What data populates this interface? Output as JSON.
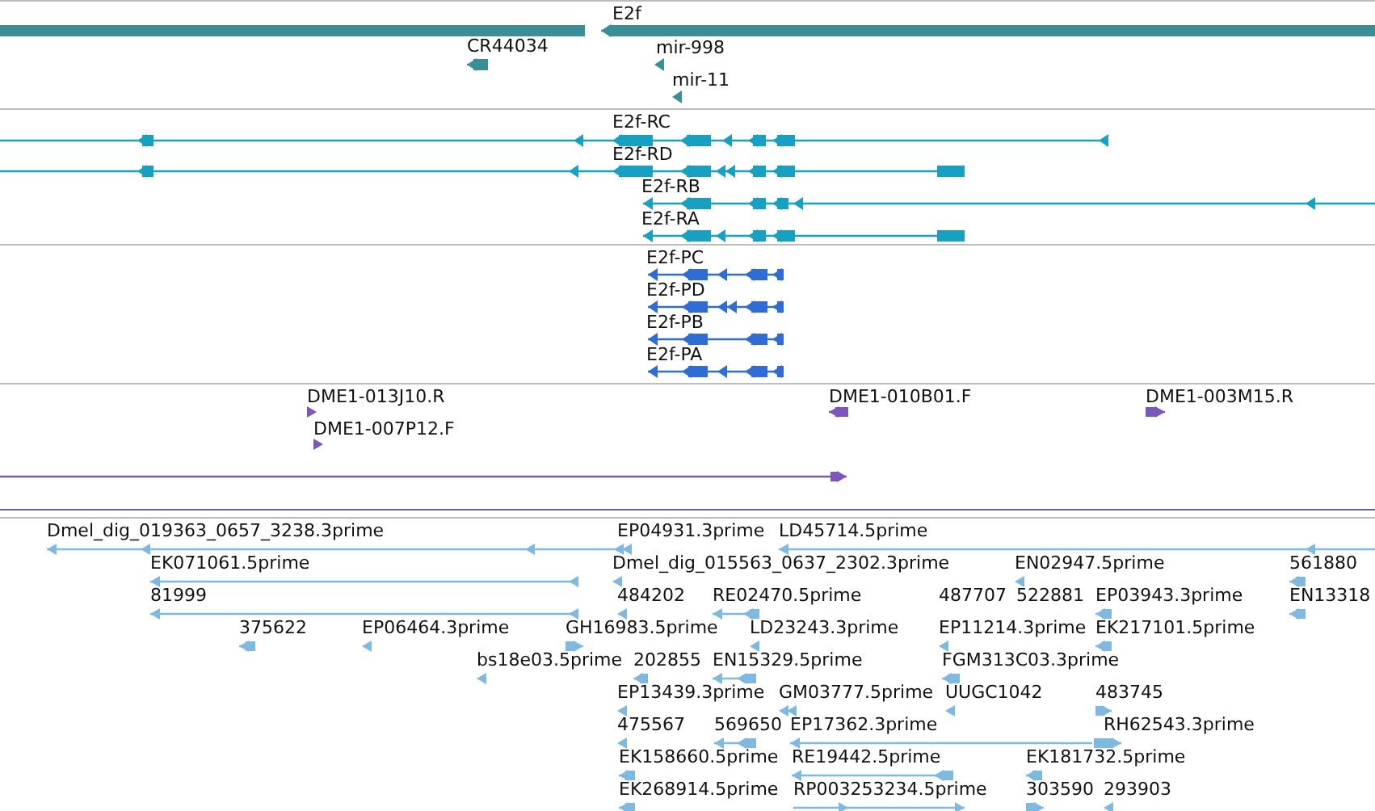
{
  "tracks": [
    {
      "kind": "gene",
      "features": [
        {
          "kind": "gene"
        },
        {
          "label": "E2f",
          "reverse": true
        },
        {
          "label": "CR44034",
          "reverse": true
        },
        {
          "label": "mir-998",
          "reverse": true
        },
        {
          "label": "mir-11",
          "reverse": true
        }
      ]
    },
    {
      "kind": "transcript",
      "features": [
        {
          "label": "E2f-RC",
          "reverse": true
        },
        {
          "label": "E2f-RD",
          "reverse": true
        },
        {
          "label": "E2f-RB",
          "reverse": true
        },
        {
          "label": "E2f-RA",
          "reverse": true
        }
      ]
    },
    {
      "kind": "protein",
      "features": [
        {
          "label": "E2f-PC",
          "reverse": true
        },
        {
          "label": "E2f-PD",
          "reverse": true
        },
        {
          "label": "E2f-PB",
          "reverse": true
        },
        {
          "label": "E2f-PA",
          "reverse": true
        }
      ]
    },
    {
      "kind": "clone",
      "features": [
        {
          "label": "DME1-013J10.R",
          "reverse": false
        },
        {
          "label": "DME1-007P12.F",
          "reverse": false
        },
        {
          "label": "DME1-010B01.F",
          "reverse": true
        },
        {
          "label": "DME1-003M15.R",
          "reverse": false
        },
        {
          "kind": "clone",
          "reverse": false
        }
      ]
    },
    {
      "kind": "est",
      "features": [
        {
          "label": "Dmel_dig_019363_0657_3238.3prime",
          "reverse": true
        },
        {
          "label": "EP04931.3prime",
          "reverse": true
        },
        {
          "label": "LD45714.5prime",
          "reverse": true
        },
        {
          "label": "EK071061.5prime",
          "reverse": true
        },
        {
          "label": "Dmel_dig_015563_0637_2302.3prime",
          "reverse": true
        },
        {
          "label": "EN02947.5prime",
          "reverse": true
        },
        {
          "label": "561880",
          "reverse": true
        },
        {
          "label": "81999",
          "reverse": true
        },
        {
          "label": "484202",
          "reverse": true
        },
        {
          "label": "RE02470.5prime",
          "reverse": true
        },
        {
          "label": "487707"
        },
        {
          "label": "522881"
        },
        {
          "label": "EP03943.3prime",
          "reverse": true
        },
        {
          "label": "EN13318",
          "reverse": true
        },
        {
          "label": "375622",
          "reverse": true
        },
        {
          "label": "EP06464.3prime",
          "reverse": true
        },
        {
          "label": "GH16983.5prime",
          "reverse": false
        },
        {
          "label": "LD23243.3prime",
          "reverse": true
        },
        {
          "label": "EP11214.3prime",
          "reverse": true
        },
        {
          "label": "EK217101.5prime",
          "reverse": true
        },
        {
          "label": "bs18e03.5prime",
          "reverse": true
        },
        {
          "label": "202855",
          "reverse": true
        },
        {
          "label": "EN15329.5prime",
          "reverse": true
        },
        {
          "label": "FGM313C03.3prime",
          "reverse": true
        },
        {
          "label": "EP13439.3prime",
          "reverse": true
        },
        {
          "label": "GM03777.5prime",
          "reverse": true
        },
        {
          "label": "UUGC1042",
          "reverse": true
        },
        {
          "label": "483745",
          "reverse": false
        },
        {
          "label": "475567",
          "reverse": true
        },
        {
          "label": "569650",
          "reverse": true
        },
        {
          "label": "EP17362.3prime",
          "reverse": true
        },
        {
          "label": "RH62543.3prime",
          "reverse": false
        },
        {
          "label": "EK158660.5prime",
          "reverse": true
        },
        {
          "label": "RE19442.5prime",
          "reverse": true
        },
        {
          "label": "EK181732.5prime",
          "reverse": true
        },
        {
          "label": "EK268914.5prime",
          "reverse": true
        },
        {
          "label": "RP003253234.5prime",
          "reverse": false
        },
        {
          "label": "303590",
          "reverse": false
        },
        {
          "label": "293903",
          "reverse": true
        }
      ]
    }
  ]
}
